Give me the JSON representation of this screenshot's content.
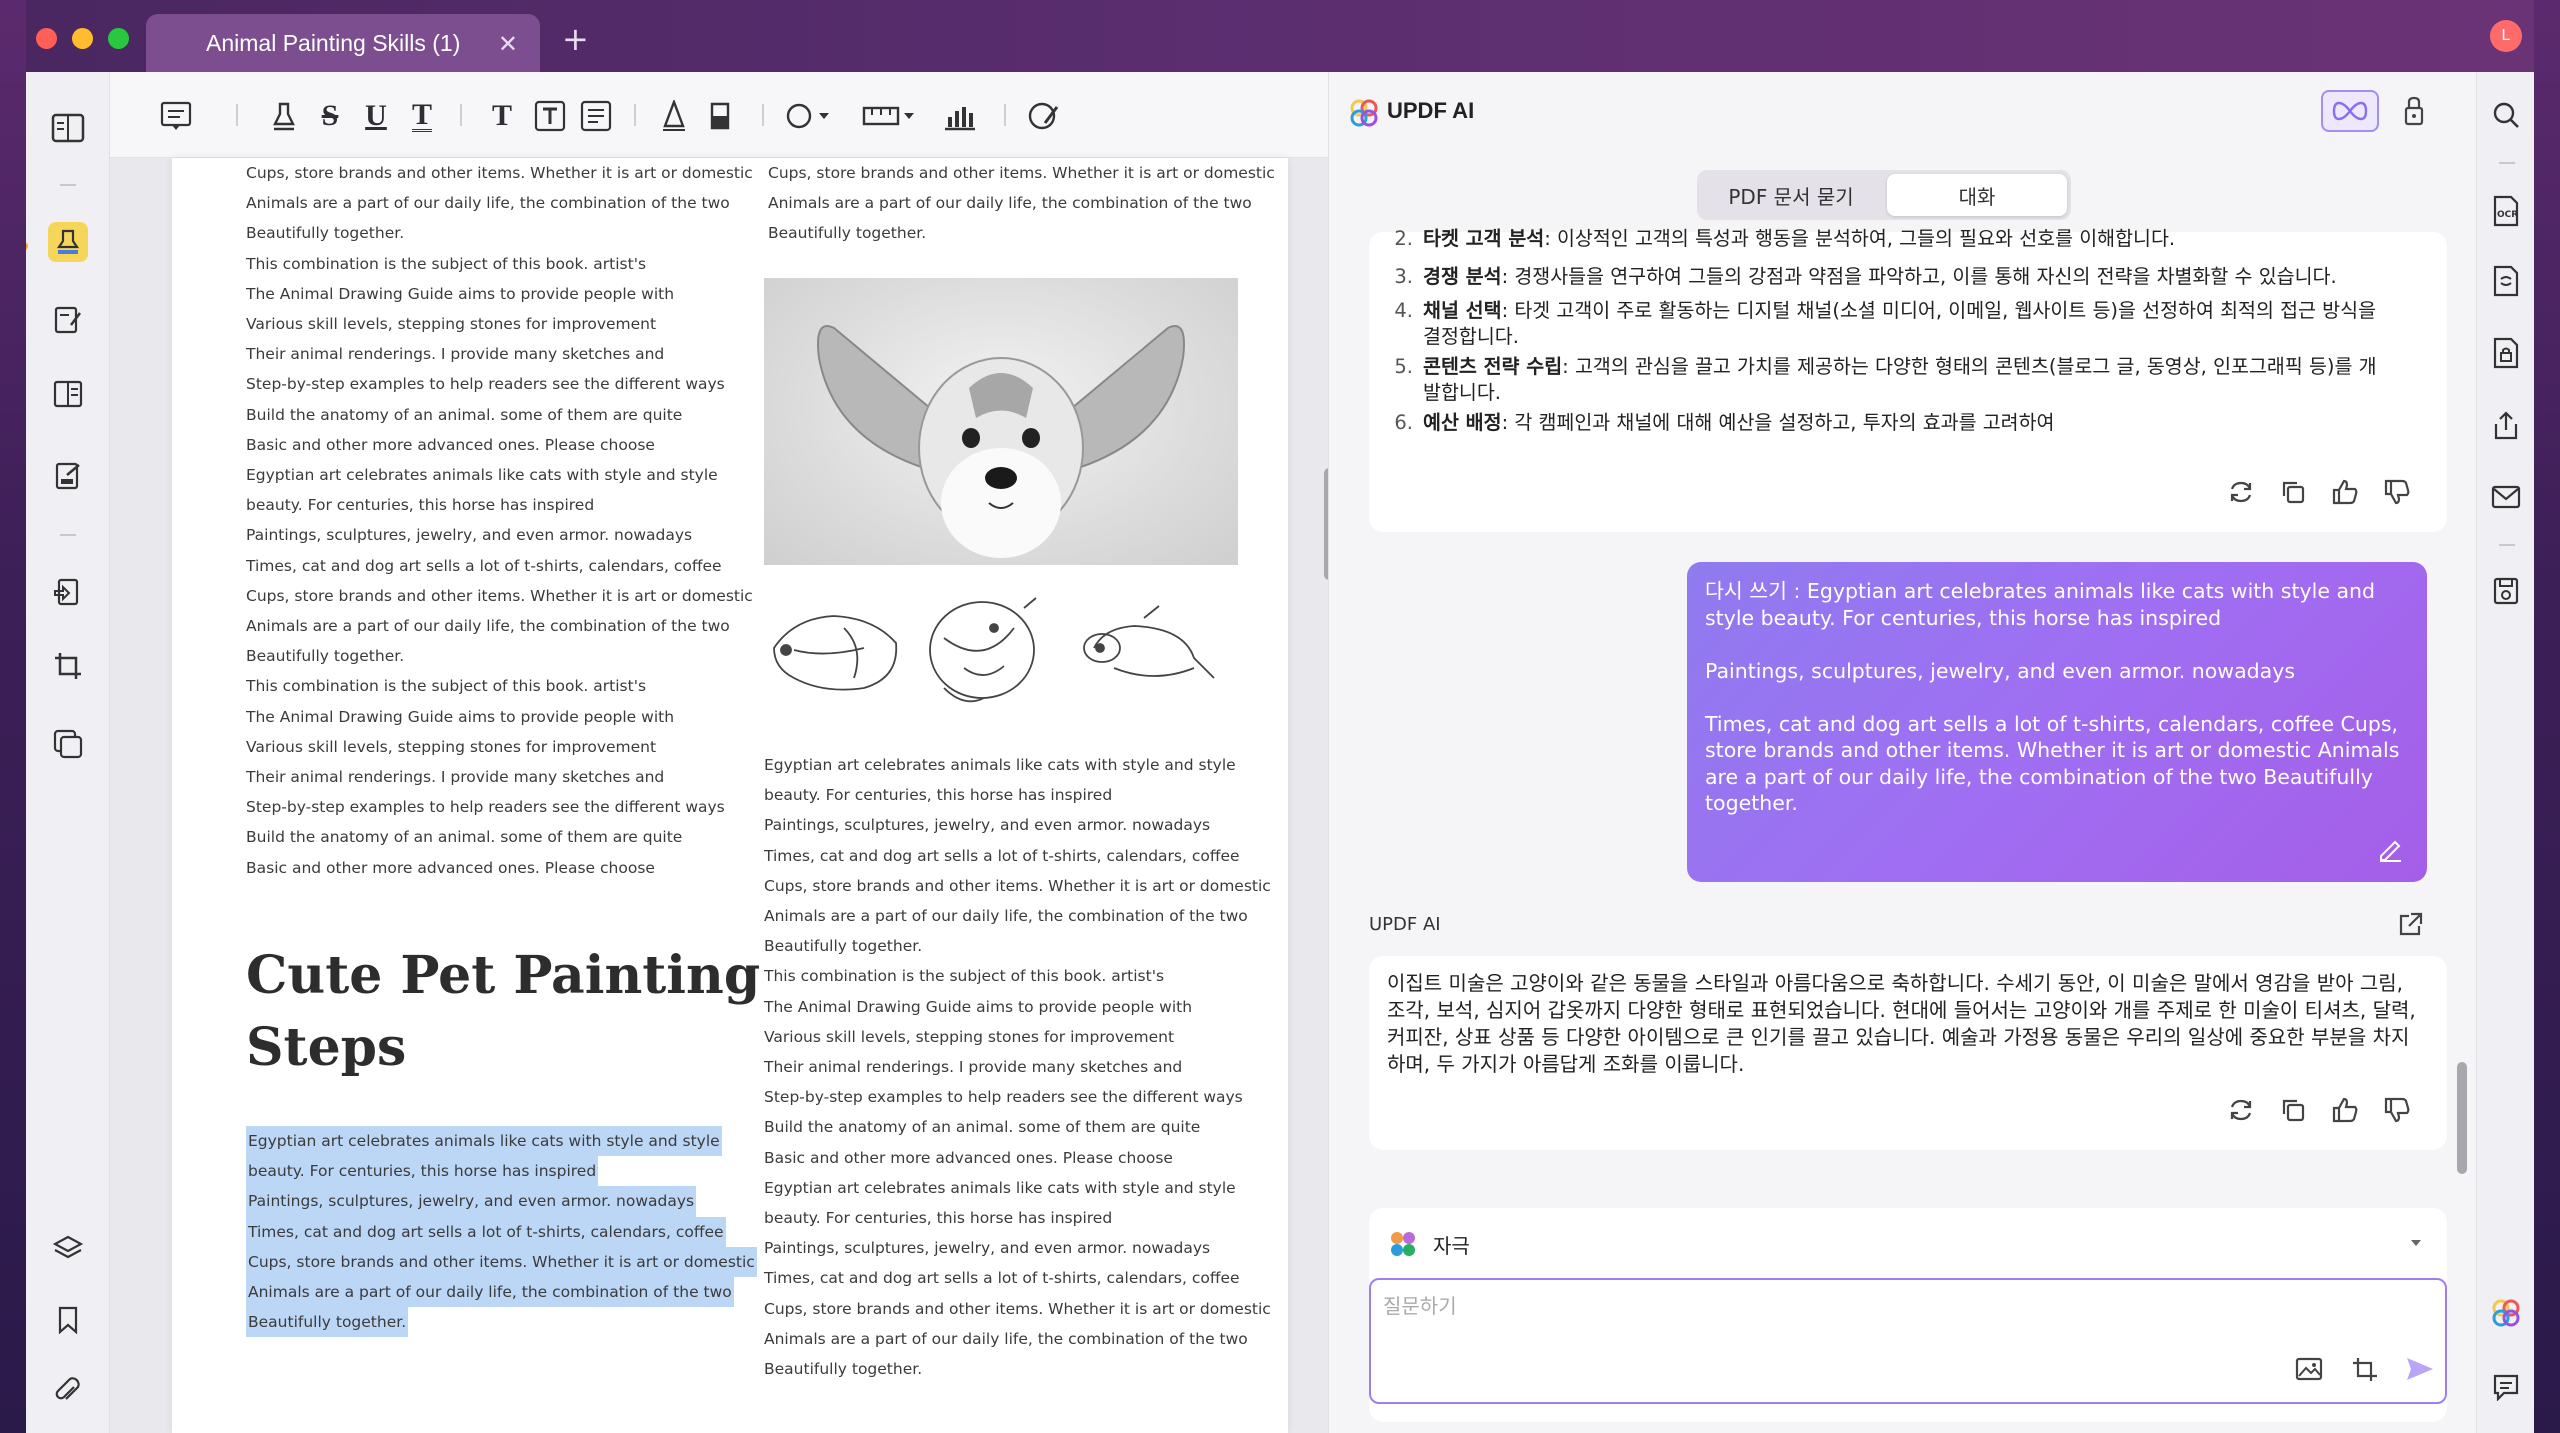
{
  "window": {
    "tab_title": "Animal Painting Skills (1)",
    "tab_close": "✕",
    "tab_add": "+",
    "avatar_letter": "L"
  },
  "doc": {
    "left_col": [
      "Cups, store brands and other items. Whether it is art or domestic",
      "Animals are a part of our daily life, the combination of the two",
      "Beautifully together.",
      "This combination is the subject of this book. artist's",
      "The Animal Drawing Guide aims to provide people with",
      "Various skill levels, stepping stones for improvement",
      "Their animal renderings. I provide many sketches and",
      "Step-by-step examples to help readers see the different ways",
      "Build the anatomy of an animal. some of them are quite",
      "Basic and other more advanced ones. Please choose",
      "Egyptian art celebrates animals like cats with style and style",
      "beauty. For centuries, this horse has inspired",
      "Paintings, sculptures, jewelry, and even armor. nowadays",
      "Times, cat and dog art sells a lot of t-shirts, calendars, coffee",
      "Cups, store brands and other items. Whether it is art or domestic",
      "Animals are a part of our daily life, the combination of the two",
      "Beautifully together.",
      "This combination is the subject of this book. artist's",
      "The Animal Drawing Guide aims to provide people with",
      "Various skill levels, stepping stones for improvement",
      "Their animal renderings. I provide many sketches and",
      "Step-by-step examples to help readers see the different ways",
      "Build the anatomy of an animal. some of them are quite",
      "Basic and other more advanced ones. Please choose"
    ],
    "heading_line1": "Cute Pet Painting",
    "heading_line2": "Steps",
    "highlighted": [
      "Egyptian art celebrates animals like cats with style and style",
      "beauty. For centuries, this horse has inspired",
      "Paintings, sculptures, jewelry, and even armor. nowadays",
      "Times, cat and dog art sells a lot of t-shirts, calendars, coffee",
      "Cups, store brands and other items. Whether it is art or domestic",
      "Animals are a part of our daily life, the combination of the two",
      "Beautifully together."
    ],
    "right_top": [
      "Cups, store brands and other items. Whether it is art or domestic",
      "Animals are a part of our daily life, the combination of the two",
      "Beautifully together."
    ],
    "right_bottom": [
      "Egyptian art celebrates animals like cats with style and style",
      "beauty. For centuries, this horse has inspired",
      "Paintings, sculptures, jewelry, and even armor. nowadays",
      "Times, cat and dog art sells a lot of t-shirts, calendars, coffee",
      "Cups, store brands and other items. Whether it is art or domestic",
      "Animals are a part of our daily life, the combination of the two",
      "Beautifully together.",
      "This combination is the subject of this book. artist's",
      "The Animal Drawing Guide aims to provide people with",
      "Various skill levels, stepping stones for improvement",
      "Their animal renderings. I provide many sketches and",
      "Step-by-step examples to help readers see the different ways",
      "Build the anatomy of an animal. some of them are quite",
      "Basic and other more advanced ones. Please choose",
      "Egyptian art celebrates animals like cats with style and style",
      "beauty. For centuries, this horse has inspired",
      "Paintings, sculptures, jewelry, and even armor. nowadays",
      "Times, cat and dog art sells a lot of t-shirts, calendars, coffee",
      "Cups, store brands and other items. Whether it is art or domestic",
      "Animals are a part of our daily life, the combination of the two",
      "Beautifully together."
    ]
  },
  "ai": {
    "title": "UPDF AI",
    "tab_pdf": "PDF 문서 묻기",
    "tab_chat": "대화",
    "list": [
      {
        "num": "2.",
        "bold": "타켓 고객 분석",
        "rest": ": 이상적인 고객의 특성과 행동을 분석하여, 그들의 필요와 선호를 이해합니다."
      },
      {
        "num": "3.",
        "bold": "경쟁 분석",
        "rest": ": 경쟁사들을 연구하여 그들의 강점과 약점을 파악하고, 이를 통해 자신의 전략을 차별화할 수 있습니다."
      },
      {
        "num": "4.",
        "bold": "채널 선택",
        "rest": ": 타겟 고객이 주로 활동하는 디지털 채널(소셜 미디어, 이메일, 웹사이트 등)을 선정하여 최적의 접근 방식을 결정합니다."
      },
      {
        "num": "5.",
        "bold": "콘텐츠 전략 수립",
        "rest": ": 고객의 관심을 끌고 가치를 제공하는 다양한 형태의 콘텐츠(블로그 글, 동영상, 인포그래픽 등)를 개발합니다."
      },
      {
        "num": "6.",
        "bold": "예산 배정",
        "rest": ": 각 캠페인과 채널에 대해 예산을 설정하고, 투자의 효과를 고려하여"
      }
    ],
    "user_msg_p1": "다시 쓰기 : Egyptian art celebrates animals like cats with style and style beauty. For centuries, this horse has inspired",
    "user_msg_p2": "Paintings, sculptures, jewelry, and even armor. nowadays",
    "user_msg_p3": "Times, cat and dog art sells a lot of t-shirts, calendars, coffee Cups, store brands and other items. Whether it is art or domestic Animals are a part of our daily life, the combination of the two Beautifully together.",
    "answer_label": "UPDF AI",
    "answer": "이집트 미술은 고양이와 같은 동물을 스타일과 아름다움으로 축하합니다. 수세기 동안, 이 미술은 말에서 영감을 받아 그림, 조각, 보석, 심지어 갑옷까지 다양한 형태로 표현되었습니다. 현대에 들어서는 고양이와 개를 주제로 한 미술이 티셔츠, 달력, 커피잔, 상표 상품 등 다양한 아이템으로 큰 인기를 끌고 있습니다. 예술과 가정용 동물은 우리의 일상에 중요한 부분을 차지하며, 두 가지가 아름답게 조화를 이룹니다.",
    "prompt_mode": "자극",
    "input_placeholder": "질문하기"
  }
}
